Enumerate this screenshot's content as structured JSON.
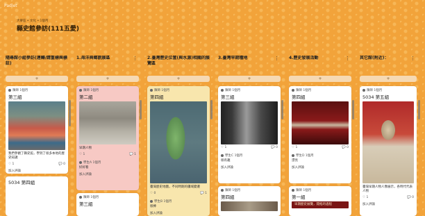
{
  "app": {
    "label": "Padlet"
  },
  "header": {
    "subtitle": "大寮區 • 文化 • 1個月",
    "title": "縣史館參訪(111五愛)"
  },
  "columns": [
    {
      "title": "隨尋館小組參訪(連轉/請重標與標註)",
      "cards": [
        {
          "author": "陳師 1個月",
          "title": "第三組",
          "desc": "我們參觀了縣史館，學到了很多本地的歷史知識",
          "likes": "1",
          "comments": "0",
          "comment_label": "加入評論"
        },
        {
          "author": "",
          "title": "5034 第四組"
        }
      ]
    },
    {
      "title": "1.海洋與鄉貌展區",
      "cards": [
        {
          "author": "陳師 1個月",
          "title": "第二組",
          "desc": "早期人物",
          "meta1": "1",
          "meta2": "1",
          "sub_author": "學生A 1個月",
          "sub_text": "好好看",
          "comment_label": "加入評論"
        },
        {
          "author": "陳師 1個月",
          "title": "第三組"
        }
      ]
    },
    {
      "title": "2.臺灣歷史位置(與水源)相關的展覽區",
      "cards": [
        {
          "author": "陳師 1個月",
          "title": "第四組",
          "desc": "臺灣歷史地圖，不同時期的疆域變遷",
          "meta1": "0",
          "meta2": "1",
          "sub_author": "學生B 1個月",
          "sub_text": "很棒",
          "comment_label": "加入評論"
        }
      ]
    },
    {
      "title": "3.臺灣早期種地",
      "cards": [
        {
          "author": "陳師 1個月",
          "title": "第三組",
          "meta1": "1",
          "meta2": "0",
          "sub_author": "學生C 1個月",
          "sub_text": "很有趣",
          "comment_label": "加入評論"
        },
        {
          "author": "陳師 1個月",
          "title": "第四組"
        }
      ]
    },
    {
      "title": "4.歷史發展活動",
      "cards": [
        {
          "author": "陳師 1個月",
          "title": "第四組",
          "meta1": "1",
          "meta2": "0",
          "sub_author": "學生D 1個月",
          "sub_text": "漂亮",
          "comment_label": "加入評論"
        },
        {
          "author": "陳師 1個月",
          "title": "第一組",
          "banner": "早期歷史展覽，開拓的過程"
        }
      ]
    },
    {
      "title": "其它館(附近)：",
      "cards": [
        {
          "author": "陳師 1個月",
          "title": "5034 第五組",
          "desc": "臺灣早期人物人像展示，各時代代表人物",
          "meta1": "1",
          "meta2": "0",
          "comment_label": "加入評論"
        }
      ]
    }
  ],
  "icons": {
    "menu": "more-vertical-icon",
    "add": "plus-icon",
    "like": "heart-icon",
    "comment": "comment-icon"
  },
  "colors": {
    "background": "#f2a33a",
    "card_pink": "#f7c9c4",
    "card_yellow": "#f8e6ad",
    "card_white": "#ffffff"
  }
}
